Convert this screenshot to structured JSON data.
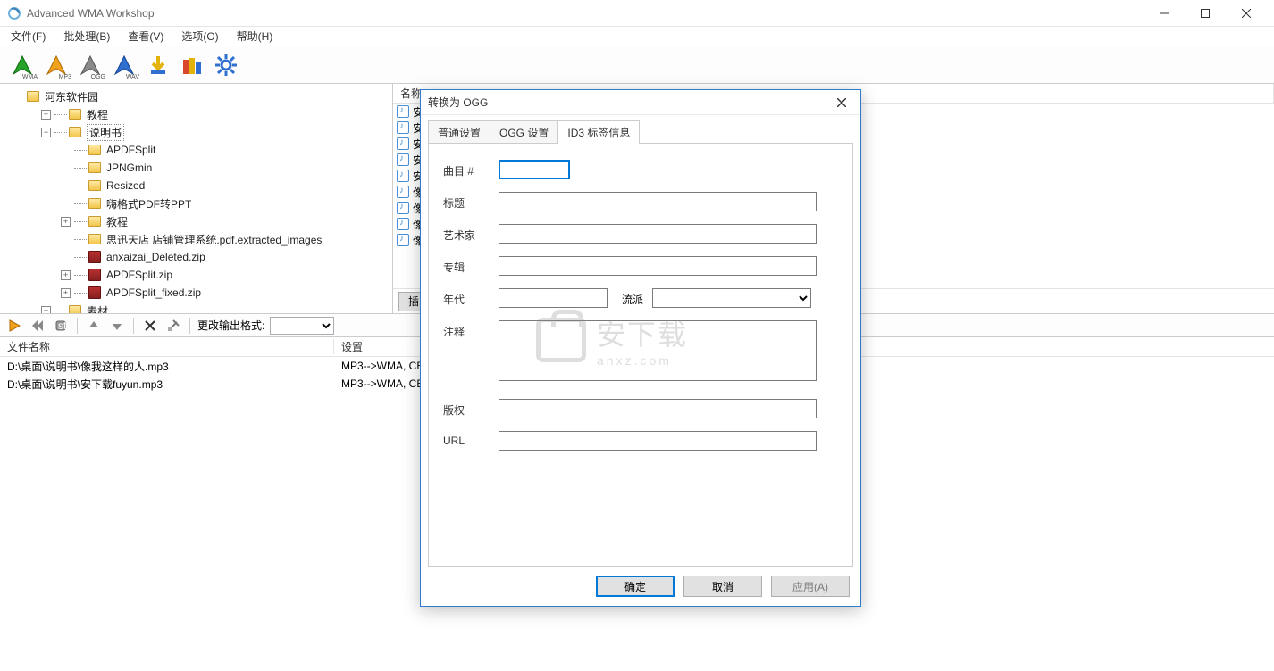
{
  "app": {
    "title": "Advanced WMA Workshop"
  },
  "menu": {
    "file": "文件(F)",
    "batch": "批处理(B)",
    "view": "查看(V)",
    "options": "选项(O)",
    "help": "帮助(H)"
  },
  "tree": {
    "root": "河东软件园",
    "items": [
      {
        "ind": 1,
        "exp": "+",
        "type": "folder",
        "label": "教程"
      },
      {
        "ind": 1,
        "exp": "-",
        "type": "folder",
        "label": "说明书",
        "sel": true
      },
      {
        "ind": 2,
        "exp": "",
        "type": "folder",
        "label": "APDFSplit"
      },
      {
        "ind": 2,
        "exp": "",
        "type": "folder",
        "label": "JPNGmin"
      },
      {
        "ind": 2,
        "exp": "",
        "type": "folder",
        "label": "Resized"
      },
      {
        "ind": 2,
        "exp": "",
        "type": "folder",
        "label": "嗨格式PDF转PPT"
      },
      {
        "ind": 2,
        "exp": "+",
        "type": "folder",
        "label": "教程"
      },
      {
        "ind": 2,
        "exp": "",
        "type": "folder",
        "label": "思迅天店 店铺管理系统.pdf.extracted_images"
      },
      {
        "ind": 2,
        "exp": "",
        "type": "zip",
        "label": "anxaizai_Deleted.zip"
      },
      {
        "ind": 2,
        "exp": "+",
        "type": "zip",
        "label": "APDFSplit.zip"
      },
      {
        "ind": 2,
        "exp": "+",
        "type": "zip",
        "label": "APDFSplit_fixed.zip"
      },
      {
        "ind": 1,
        "exp": "+",
        "type": "folder",
        "label": "素材"
      }
    ]
  },
  "file_list": {
    "col_name": "名称",
    "button": "插",
    "rows": [
      {
        "icon": "audio",
        "label": "安"
      },
      {
        "icon": "audio",
        "label": "安"
      },
      {
        "icon": "audio",
        "label": "安"
      },
      {
        "icon": "audio",
        "label": "安"
      },
      {
        "icon": "audio",
        "label": "安"
      },
      {
        "icon": "disc",
        "label": "像"
      },
      {
        "icon": "disc",
        "label": "像"
      },
      {
        "icon": "music",
        "label": "像"
      },
      {
        "icon": "disc",
        "label": "像"
      }
    ]
  },
  "sec_toolbar": {
    "label": "更改输出格式:"
  },
  "queue": {
    "col_file": "文件名称",
    "col_settings": "设置",
    "rows": [
      {
        "file": "D:\\桌面\\说明书\\像我这样的人.mp3",
        "settings": "MP3-->WMA, CBR"
      },
      {
        "file": "D:\\桌面\\说明书\\安下载fuyun.mp3",
        "settings": "MP3-->WMA, CBR"
      }
    ]
  },
  "dialog": {
    "title": "转换为 OGG",
    "tabs": {
      "general": "普通设置",
      "ogg": "OGG 设置",
      "id3": "ID3 标签信息"
    },
    "fields": {
      "track": "曲目 #",
      "title": "标题",
      "artist": "艺术家",
      "album": "专辑",
      "year": "年代",
      "genre": "流派",
      "comment": "注释",
      "copyright": "版权",
      "url": "URL"
    },
    "buttons": {
      "ok": "确定",
      "cancel": "取消",
      "apply": "应用(A)"
    }
  },
  "watermark": {
    "big": "安下载",
    "small": "anxz.com"
  }
}
